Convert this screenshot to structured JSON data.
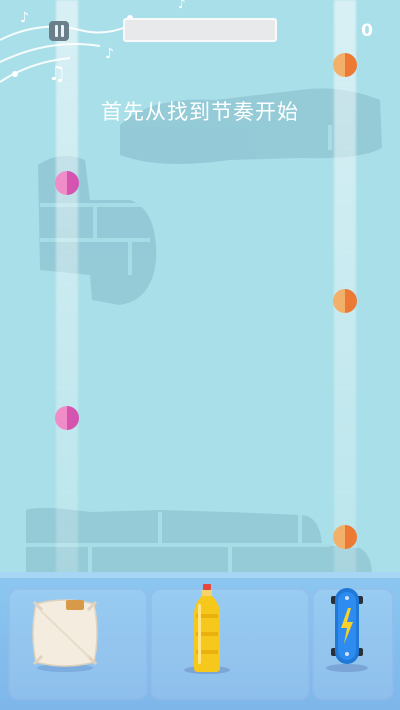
{
  "hud": {
    "pause_icon": "pause-icon",
    "progress": 0,
    "score": "0"
  },
  "hint_text": "首先从找到节奏开始",
  "notes": [
    {
      "lane": "left",
      "color": "pink"
    },
    {
      "lane": "left",
      "color": "pink"
    },
    {
      "lane": "left",
      "color": "pink"
    },
    {
      "lane": "right",
      "color": "orange"
    },
    {
      "lane": "right",
      "color": "orange"
    },
    {
      "lane": "right",
      "color": "orange"
    }
  ],
  "instruments": [
    {
      "name": "pillow",
      "icon": "pillow-icon"
    },
    {
      "name": "bottle",
      "icon": "bottle-icon"
    },
    {
      "name": "skateboard",
      "icon": "skateboard-icon"
    }
  ],
  "colors": {
    "background": "#a9dfe8",
    "floor": "#8cc7f0",
    "note_pink": "#d454b0",
    "note_orange": "#ec7a34",
    "bottle": "#f6c81c",
    "skateboard": "#1f79d6"
  }
}
